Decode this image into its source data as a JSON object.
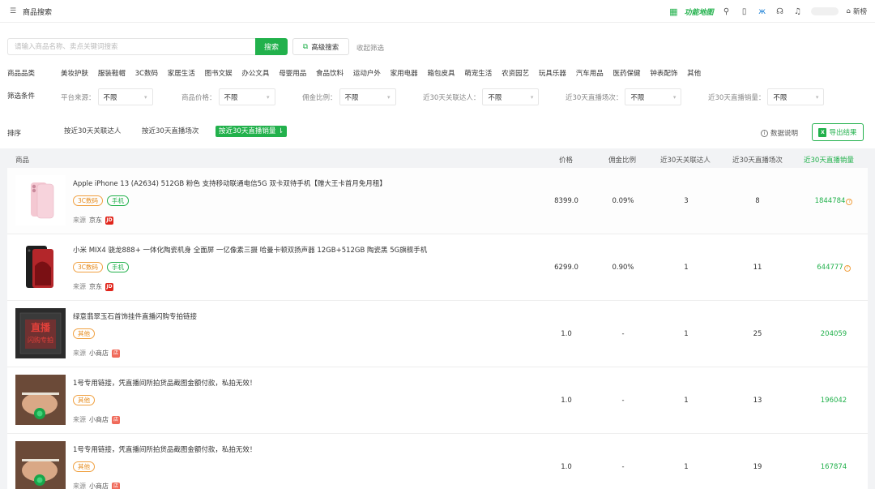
{
  "topbar": {
    "title": "商品搜索",
    "feature_map": "功能地图",
    "new_mode": "新榜"
  },
  "search": {
    "placeholder": "请输入商品名称、卖点关键词搜索",
    "button": "搜索",
    "advanced": "高级搜索",
    "collapse": "收起筛选"
  },
  "filters": {
    "category_label": "商品品类",
    "categories": [
      "美妆护肤",
      "服装鞋帽",
      "3C数码",
      "家居生活",
      "图书文娱",
      "办公文具",
      "母婴用品",
      "食品饮料",
      "运动户外",
      "家用电器",
      "箱包皮具",
      "萌宠生活",
      "农资园艺",
      "玩具乐器",
      "汽车用品",
      "医药保健",
      "钟表配饰",
      "其他"
    ],
    "condition_label": "筛选条件",
    "conditions": [
      {
        "label": "平台来源：",
        "value": "不限"
      },
      {
        "label": "商品价格：",
        "value": "不限"
      },
      {
        "label": "佣金比例：",
        "value": "不限"
      },
      {
        "label": "近30天关联达人：",
        "value": "不限"
      },
      {
        "label": "近30天直播场次：",
        "value": "不限"
      },
      {
        "label": "近30天直播销量：",
        "value": "不限"
      }
    ]
  },
  "sort": {
    "label": "排序",
    "options": [
      "按近30天关联达人",
      "按近30天直播场次",
      "按近30天直播销量 ⇂"
    ],
    "active_index": 2,
    "data_note": "数据说明",
    "export": "导出结果"
  },
  "table": {
    "headers": {
      "product": "商品",
      "price": "价格",
      "commission": "佣金比例",
      "kol30": "近30天关联达人",
      "lives30": "近30天直播场次",
      "sales30": "近30天直播销量"
    },
    "rows": [
      {
        "name": "Apple iPhone 13 (A2634) 512GB 粉色 支持移动联通电信5G 双卡双待手机【赠大王卡首月免月租】",
        "tags": [
          "3C数码",
          "手机"
        ],
        "source_label": "来源",
        "source": "京东",
        "source_badge": "JD",
        "price": "8399.0",
        "commission": "0.09%",
        "kol": "3",
        "lives": "8",
        "sales": "1844784",
        "help": "?"
      },
      {
        "name": "小米 MIX4 骁龙888+ 一体化陶瓷机身 全面屏 一亿像素三摄 哈曼卡顿双扬声器 12GB+512GB 陶瓷黑 5G旗舰手机",
        "tags": [
          "3C数码",
          "手机"
        ],
        "source_label": "来源",
        "source": "京东",
        "source_badge": "JD",
        "price": "6299.0",
        "commission": "0.90%",
        "kol": "1",
        "lives": "11",
        "sales": "644777",
        "help": "?"
      },
      {
        "name": "绿意翡翠玉石首饰挂件直播闪购专拍链接",
        "tags": [
          "其他"
        ],
        "source_label": "来源",
        "source": "小商店",
        "source_badge": "店",
        "price": "1.0",
        "commission": "-",
        "kol": "1",
        "lives": "25",
        "sales": "204059",
        "thumb_text": [
          "直播",
          "闪购专拍"
        ]
      },
      {
        "name": "1号专用链接，凭直播间所拍货品截图金额付款，私拍无效！",
        "tags": [
          "其他"
        ],
        "source_label": "来源",
        "source": "小商店",
        "source_badge": "店",
        "price": "1.0",
        "commission": "-",
        "kol": "1",
        "lives": "13",
        "sales": "196042"
      },
      {
        "name": "1号专用链接，凭直播间所拍货品截图金额付款，私拍无效！",
        "tags": [
          "其他"
        ],
        "source_label": "来源",
        "source": "小商店",
        "source_badge": "店",
        "price": "1.0",
        "commission": "-",
        "kol": "1",
        "lives": "19",
        "sales": "167874"
      }
    ]
  },
  "colors": {
    "accent": "#22b14c",
    "tag_orange": "#e68a1a",
    "jd_red": "#e1251b"
  },
  "icons": {
    "menu": "menu-icon",
    "grid": "grid-icon",
    "search": "search-icon",
    "phone": "mobile-icon",
    "butterfly": "butterfly-icon",
    "support": "headset-icon",
    "bell": "bell-icon",
    "home": "home-icon",
    "advanced": "filter-icon",
    "info": "info-icon",
    "excel": "excel-icon"
  }
}
